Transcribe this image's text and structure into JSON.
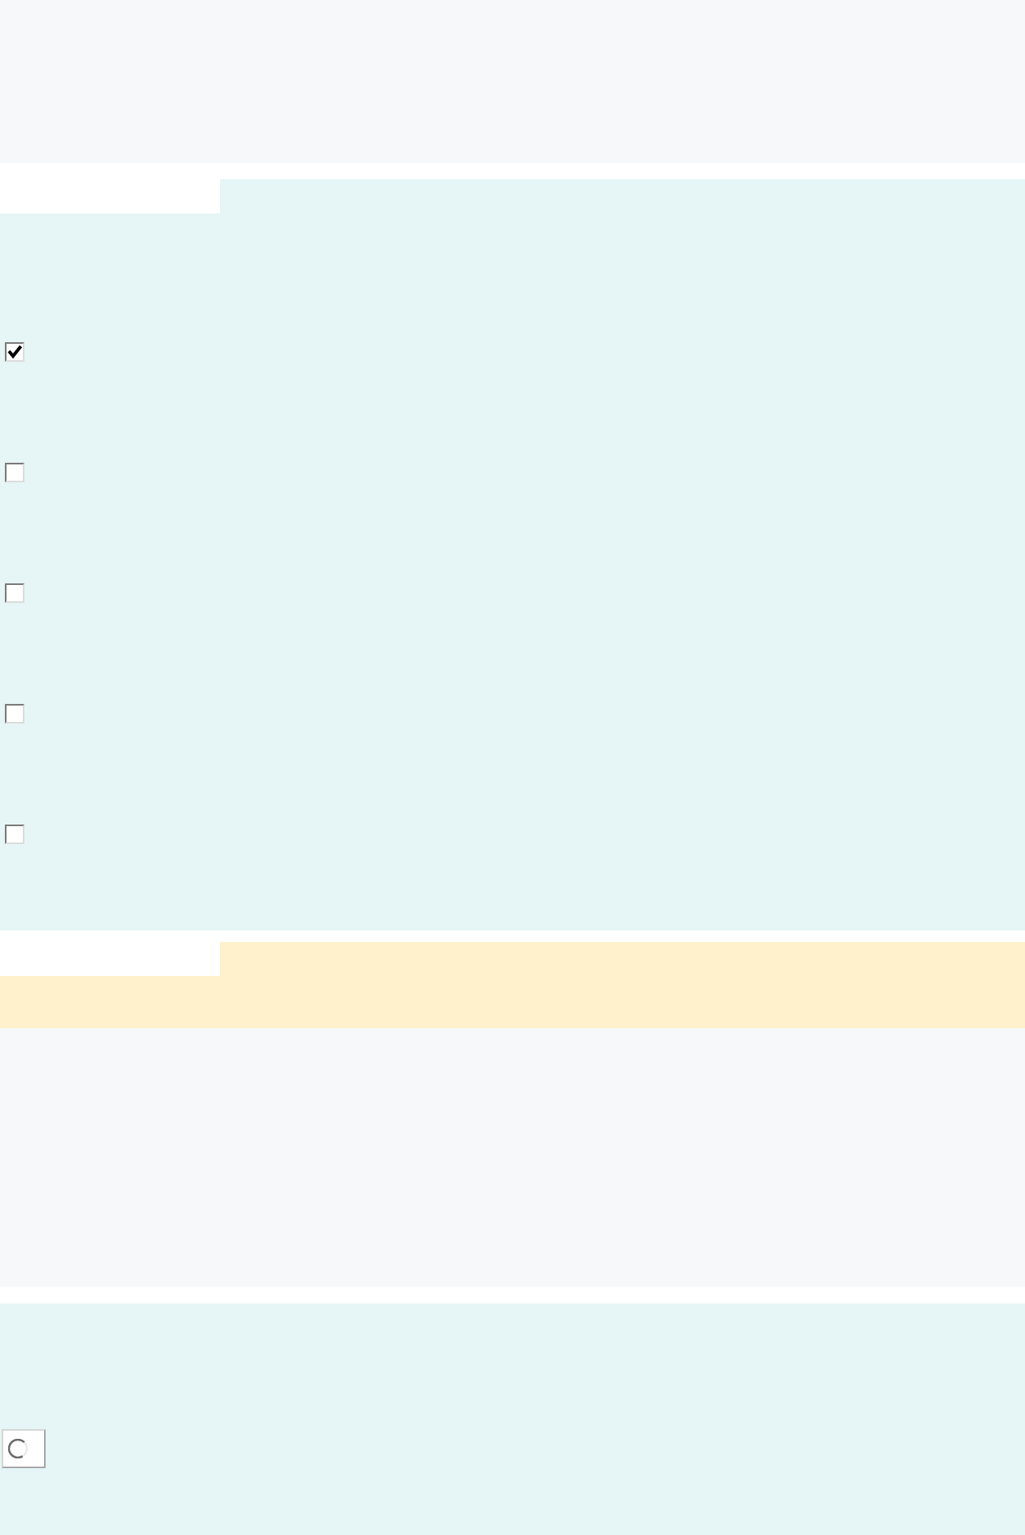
{
  "sections": [
    {
      "kind": "masthead"
    },
    {
      "kind": "form",
      "checkboxes": [
        {
          "checked": true
        },
        {
          "checked": false
        },
        {
          "checked": false
        },
        {
          "checked": false
        },
        {
          "checked": false
        }
      ]
    },
    {
      "kind": "notice"
    },
    {
      "kind": "blank"
    },
    {
      "kind": "form",
      "options": [
        {
          "selected": false
        }
      ]
    }
  ]
}
